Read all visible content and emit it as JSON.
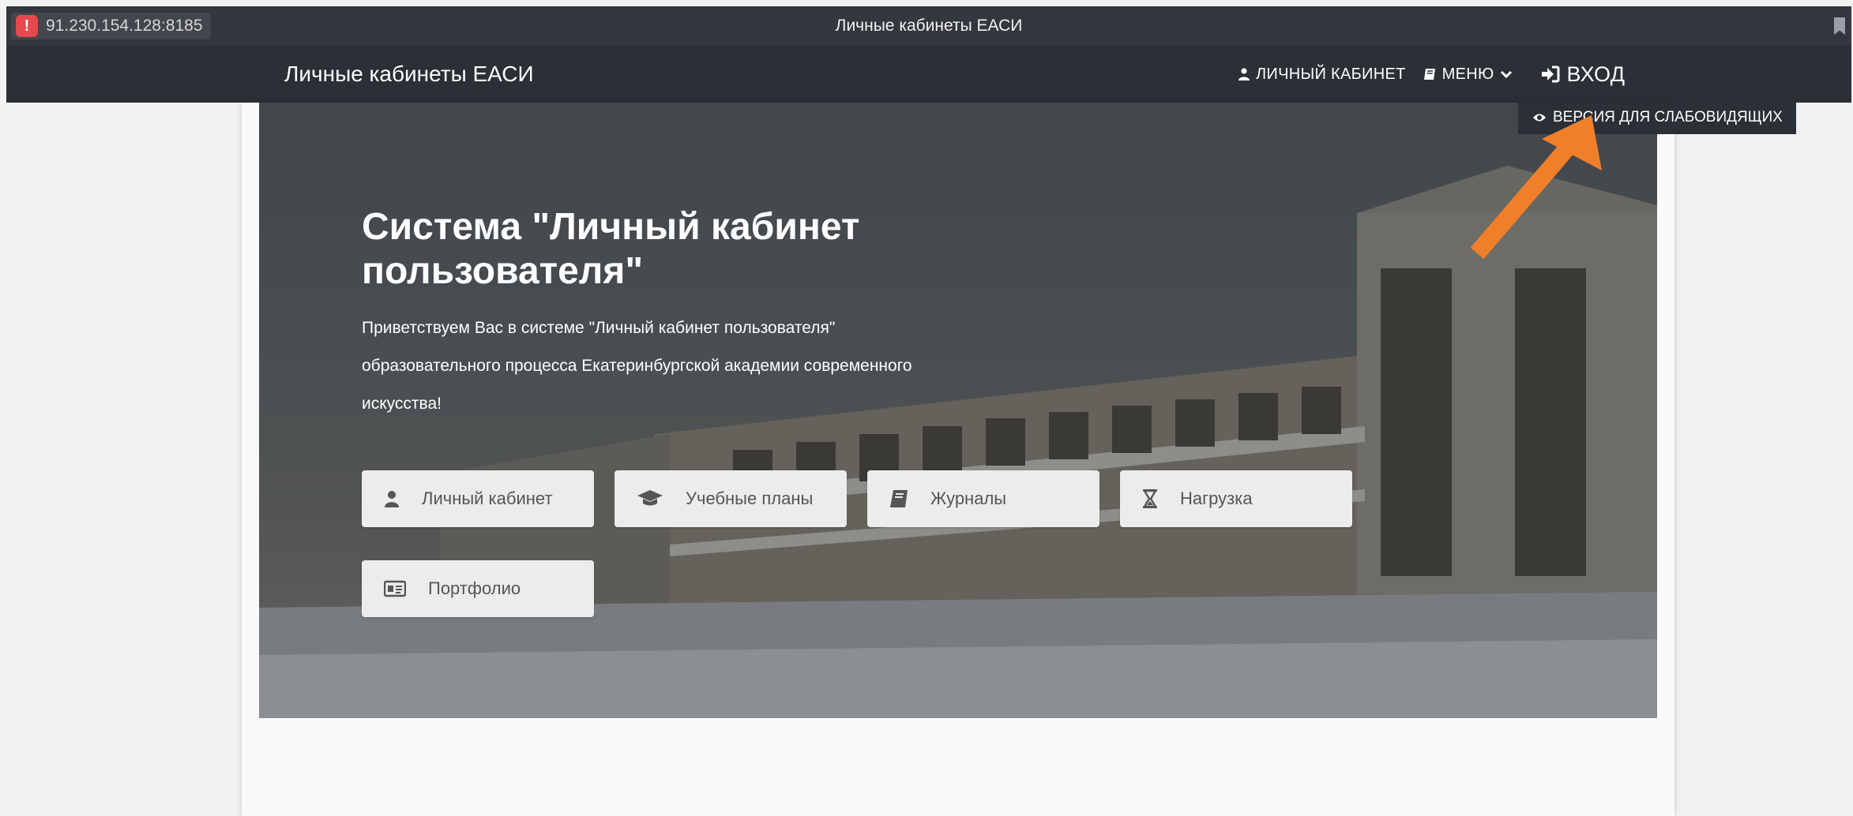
{
  "browser": {
    "url": "91.230.154.128:8185",
    "window_title": "Личные кабинеты ЕАСИ"
  },
  "navbar": {
    "brand": "Личные кабинеты ЕАСИ",
    "items": [
      {
        "label": "ЛИЧНЫЙ КАБИНЕТ",
        "icon": "user-icon"
      },
      {
        "label": "МЕНЮ",
        "icon": "book-icon"
      },
      {
        "label": "ВХОД",
        "icon": "sign-in-icon"
      }
    ],
    "low_vision": "ВЕРСИЯ ДЛЯ СЛАБОВИДЯЩИХ"
  },
  "hero": {
    "title": "Система \"Личный кабинет пользователя\"",
    "text": "Приветствуем Вас в системе \"Личный кабинет пользователя\" образовательного процесса Екатеринбургской академии современного искусства!"
  },
  "tiles": [
    {
      "label": "Личный кабинет",
      "icon": "user-icon"
    },
    {
      "label": "Учебные планы",
      "icon": "graduation-cap-icon"
    },
    {
      "label": "Журналы",
      "icon": "book-icon"
    },
    {
      "label": "Нагрузка",
      "icon": "hourglass-icon"
    },
    {
      "label": "Портфолио",
      "icon": "id-card-icon"
    }
  ],
  "colors": {
    "navbar": "#2b2f36",
    "arrow": "#f07f2a",
    "tile_bg": "#ececec"
  }
}
